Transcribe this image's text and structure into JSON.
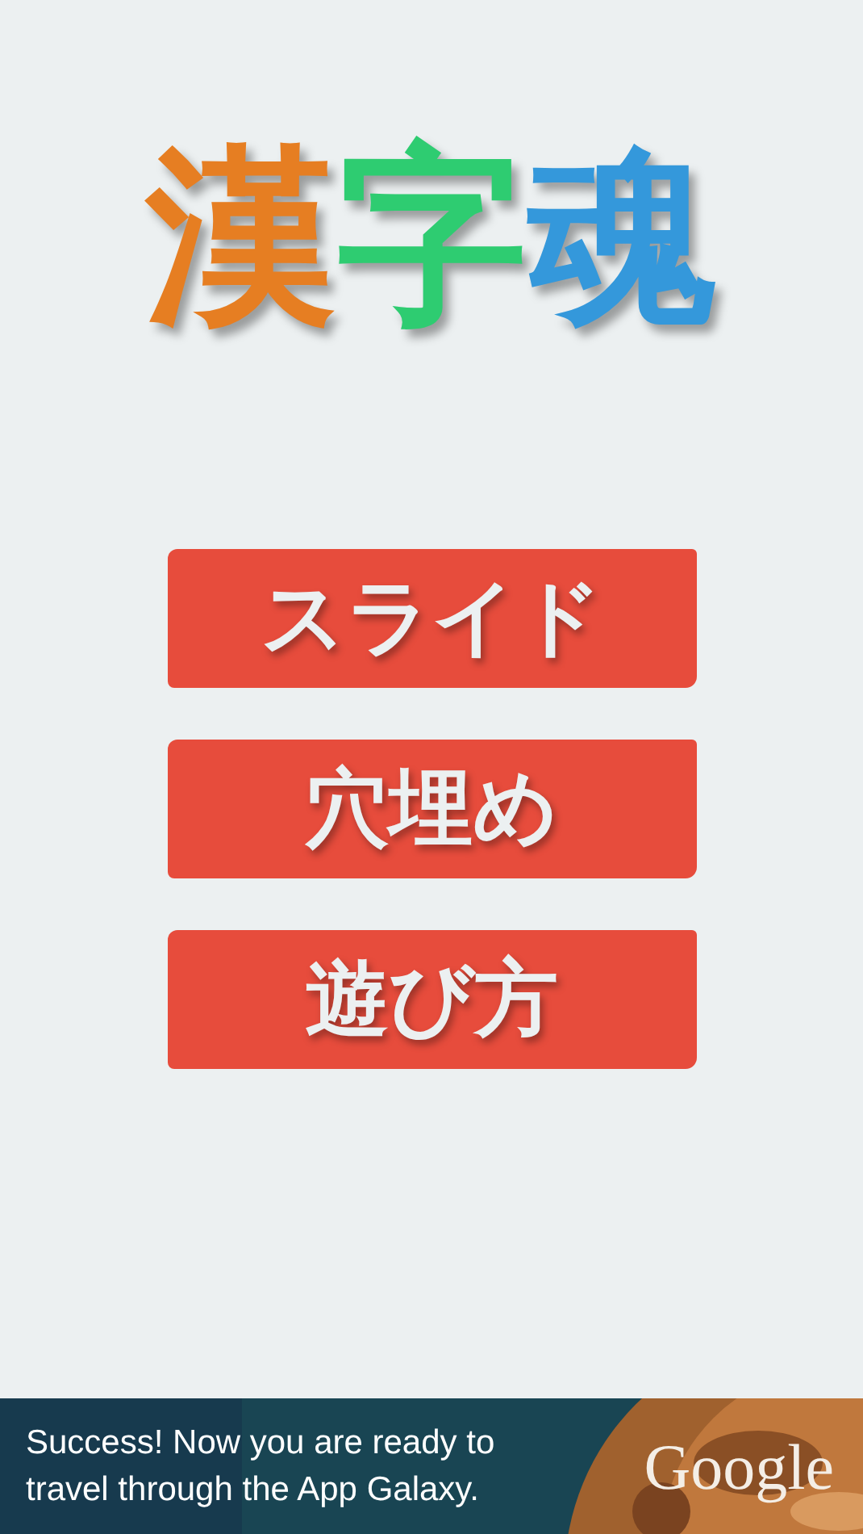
{
  "title": [
    {
      "char": "漢",
      "color": "#e67e22"
    },
    {
      "char": "字",
      "color": "#2ecc71"
    },
    {
      "char": "魂",
      "color": "#3498db"
    }
  ],
  "menu": [
    {
      "label": "スライド"
    },
    {
      "label": "穴埋め"
    },
    {
      "label": "遊び方"
    }
  ],
  "ad_banner": {
    "lines": [
      "Success! Now you are ready to",
      "travel through the App Galaxy."
    ],
    "brand": "Google"
  }
}
